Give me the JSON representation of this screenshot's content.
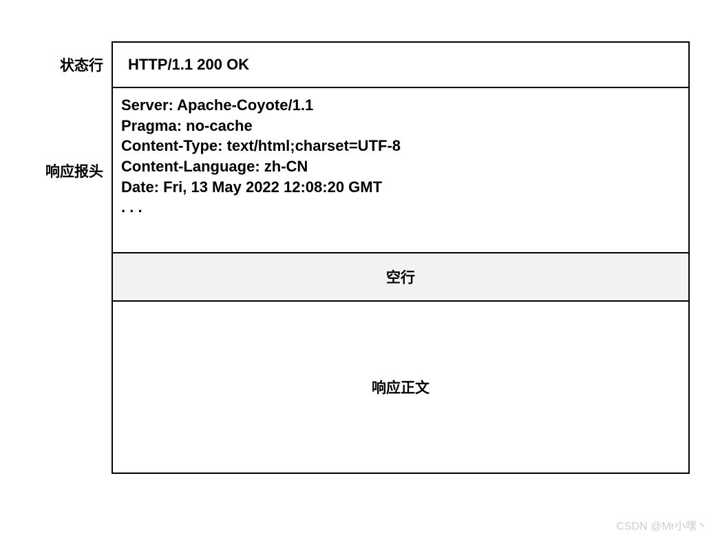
{
  "labels": {
    "status_line": "状态行",
    "response_headers": "响应报头",
    "empty_line": "空行",
    "response_body": "响应正文"
  },
  "status_line": "HTTP/1.1 200 OK",
  "headers": [
    "Server: Apache-Coyote/1.1",
    "Pragma: no-cache",
    "Content-Type: text/html;charset=UTF-8",
    "Content-Language: zh-CN",
    "Date: Fri, 13 May 2022 12:08:20 GMT",
    ". . ."
  ],
  "watermark": "CSDN @Mr小嘿丶"
}
